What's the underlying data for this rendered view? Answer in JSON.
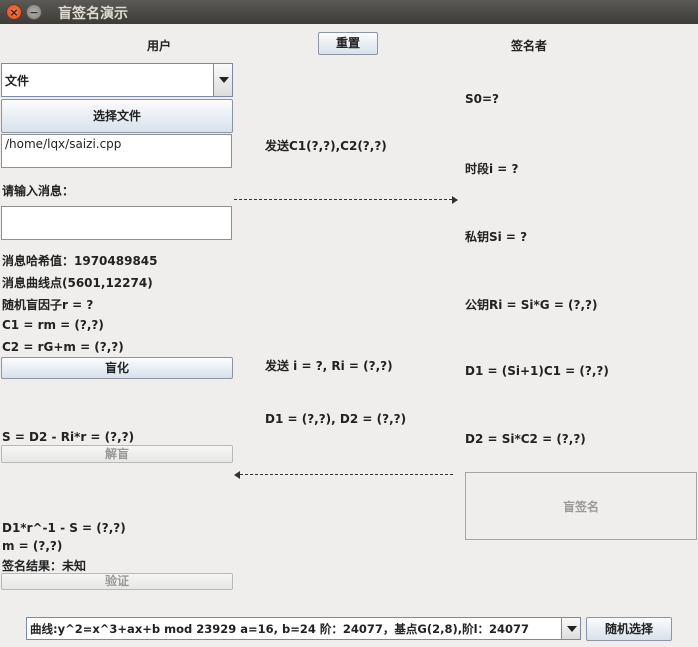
{
  "window": {
    "title": "盲签名演示"
  },
  "header": {
    "user_label": "用户",
    "reset_label": "重置",
    "signer_label": "签名者"
  },
  "user": {
    "type_select": "文件",
    "choose_file_label": "选择文件",
    "file_path": "/home/lqx/saizi.cpp",
    "message_prompt": "请输入消息：",
    "message_value": "",
    "hash": "消息哈希值：1970489845",
    "curve_point": "消息曲线点(5601,12274)",
    "blind_factor": "随机盲因子r = ?",
    "c1": "C1 = rm = (?,?)",
    "c2": "C2 = rG+m = (?,?)",
    "blind_button": "盲化",
    "s_value": "S = D2 - Ri*r = (?,?)",
    "unblind_button": "解盲",
    "check_expr": "D1*r^-1 - S = (?,?)",
    "m_value": "m = (?,?)",
    "sign_result": "签名结果：未知",
    "verify_button": "验证"
  },
  "middle": {
    "send_c": "发送C1(?,?),C2(?,?)",
    "send_i": "发送 i = ?, Ri = (?,?)",
    "d_values": "D1 = (?,?), D2 = (?,?)"
  },
  "signer": {
    "s0": "S0=?",
    "period": "时段i = ?",
    "private_key": "私钥Si = ?",
    "public_key": "公钥Ri = Si*G = (?,?)",
    "d1": "D1 = (Si+1)C1 = (?,?)",
    "d2": "D2 = Si*C2 = (?,?)",
    "sign_button": "盲签名"
  },
  "footer": {
    "curve_select": "曲线:y^2=x^3+ax+b mod 23929  a=16, b=24 阶：24077，基点G(2,8),阶l：24077",
    "random_button": "随机选择"
  },
  "icons": {
    "close": "close-icon",
    "minimize": "minimize-icon",
    "dropdown": "chevron-down-icon",
    "arrow": "arrow-icon"
  }
}
